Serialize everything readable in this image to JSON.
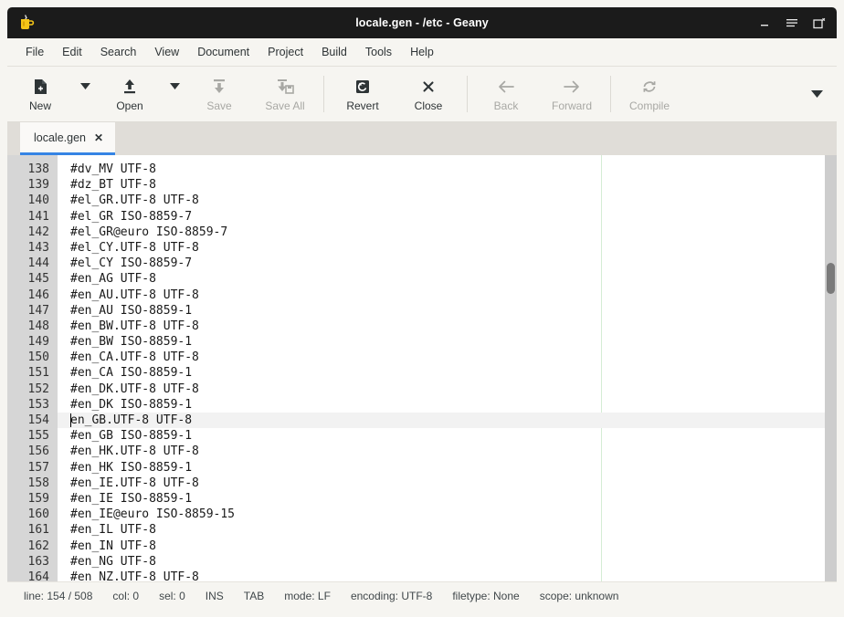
{
  "window": {
    "title": "locale.gen - /etc - Geany",
    "logo_icon": "geany-mug-icon",
    "controls": [
      {
        "name": "minimize-button",
        "icon": "minimize-icon"
      },
      {
        "name": "menu-button",
        "icon": "hamburger-menu-icon"
      },
      {
        "name": "restore-button",
        "icon": "restore-window-icon"
      }
    ]
  },
  "menubar": {
    "items": [
      {
        "label": "File"
      },
      {
        "label": "Edit"
      },
      {
        "label": "Search"
      },
      {
        "label": "View"
      },
      {
        "label": "Document"
      },
      {
        "label": "Project"
      },
      {
        "label": "Build"
      },
      {
        "label": "Tools"
      },
      {
        "label": "Help"
      }
    ]
  },
  "toolbar": {
    "new_label": "New",
    "open_label": "Open",
    "save_label": "Save",
    "save_all_label": "Save All",
    "revert_label": "Revert",
    "close_label": "Close",
    "back_label": "Back",
    "forward_label": "Forward",
    "compile_label": "Compile",
    "overflow_icon": "chevron-down-icon"
  },
  "tabs": [
    {
      "label": "locale.gen",
      "close_icon": "✕",
      "active": true
    }
  ],
  "editor": {
    "first_line_number": 138,
    "current_line": 154,
    "margin_column_x": 595,
    "lines": [
      {
        "n": 138,
        "text": "#dv_MV UTF-8"
      },
      {
        "n": 139,
        "text": "#dz_BT UTF-8"
      },
      {
        "n": 140,
        "text": "#el_GR.UTF-8 UTF-8"
      },
      {
        "n": 141,
        "text": "#el_GR ISO-8859-7"
      },
      {
        "n": 142,
        "text": "#el_GR@euro ISO-8859-7"
      },
      {
        "n": 143,
        "text": "#el_CY.UTF-8 UTF-8"
      },
      {
        "n": 144,
        "text": "#el_CY ISO-8859-7"
      },
      {
        "n": 145,
        "text": "#en_AG UTF-8"
      },
      {
        "n": 146,
        "text": "#en_AU.UTF-8 UTF-8"
      },
      {
        "n": 147,
        "text": "#en_AU ISO-8859-1"
      },
      {
        "n": 148,
        "text": "#en_BW.UTF-8 UTF-8"
      },
      {
        "n": 149,
        "text": "#en_BW ISO-8859-1"
      },
      {
        "n": 150,
        "text": "#en_CA.UTF-8 UTF-8"
      },
      {
        "n": 151,
        "text": "#en_CA ISO-8859-1"
      },
      {
        "n": 152,
        "text": "#en_DK.UTF-8 UTF-8"
      },
      {
        "n": 153,
        "text": "#en_DK ISO-8859-1"
      },
      {
        "n": 154,
        "text": "en_GB.UTF-8 UTF-8"
      },
      {
        "n": 155,
        "text": "#en_GB ISO-8859-1"
      },
      {
        "n": 156,
        "text": "#en_HK.UTF-8 UTF-8"
      },
      {
        "n": 157,
        "text": "#en_HK ISO-8859-1"
      },
      {
        "n": 158,
        "text": "#en_IE.UTF-8 UTF-8"
      },
      {
        "n": 159,
        "text": "#en_IE ISO-8859-1"
      },
      {
        "n": 160,
        "text": "#en_IE@euro ISO-8859-15"
      },
      {
        "n": 161,
        "text": "#en_IL UTF-8"
      },
      {
        "n": 162,
        "text": "#en_IN UTF-8"
      },
      {
        "n": 163,
        "text": "#en_NG UTF-8"
      },
      {
        "n": 164,
        "text": "#en_NZ.UTF-8 UTF-8"
      }
    ]
  },
  "statusbar": {
    "line": "line: 154 / 508",
    "col": "col: 0",
    "sel": "sel: 0",
    "insert_mode": "INS",
    "indent": "TAB",
    "eol_mode": "mode: LF",
    "encoding": "encoding: UTF-8",
    "filetype": "filetype: None",
    "scope": "scope: unknown"
  },
  "colors": {
    "titlebar_bg": "#1b1b1b",
    "chrome_bg": "#f6f5f1",
    "tabbar_bg": "#e0ddd8",
    "tab_active_accent": "#3584e4",
    "gutter_bg": "#d6d6d6",
    "editor_bg": "#ffffff",
    "current_line_bg": "#f2f2f2",
    "margin_line": "#d4ecd4",
    "scrollbar_thumb": "#7a7a7a"
  }
}
